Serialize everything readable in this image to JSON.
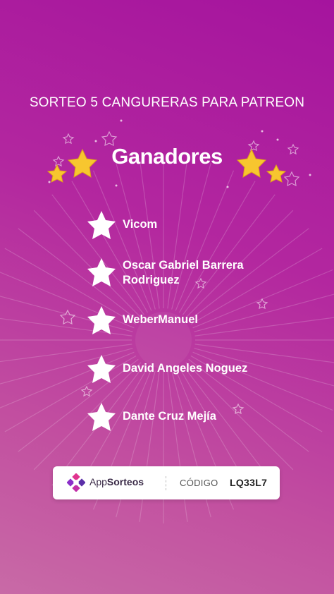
{
  "title": "SORTEO 5 CANGURERAS PARA PATREON",
  "heading": "Ganadores",
  "winners": [
    {
      "name": "Vicom"
    },
    {
      "name": "Oscar Gabriel Barrera Rodriguez"
    },
    {
      "name": "WeberManuel"
    },
    {
      "name": "David Angeles Noguez"
    },
    {
      "name": "Dante Cruz Mejía"
    }
  ],
  "footer": {
    "brand_prefix": "App",
    "brand_suffix": "Sorteos",
    "code_label": "CÓDIGO",
    "code_value": "LQ33L7"
  },
  "colors": {
    "background_top": "#a5149e",
    "background_bottom": "#c86aa6",
    "gold_star": "#f7c62f",
    "text": "#ffffff"
  },
  "icons": {
    "winner_marker": "star-icon",
    "heading_decoration": "gold-star-icon",
    "brand_logo": "appsorteos-logo-icon"
  }
}
